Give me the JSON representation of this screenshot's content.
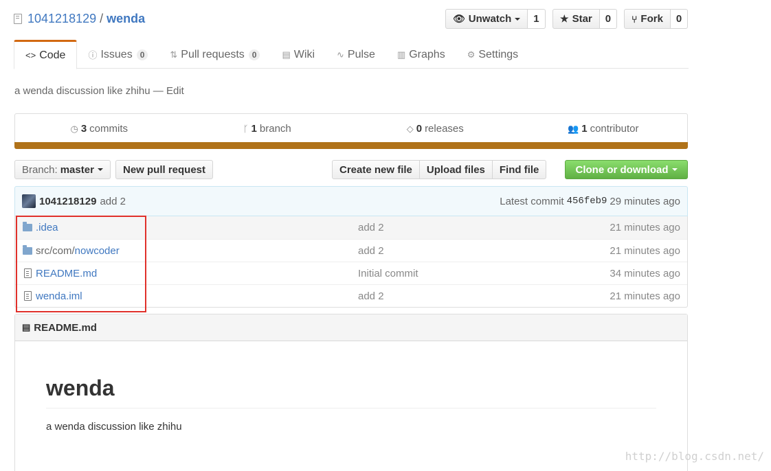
{
  "repo": {
    "owner": "1041218129",
    "separator": "/",
    "name": "wenda"
  },
  "actions": {
    "unwatch_label": "Unwatch",
    "unwatch_count": "1",
    "star_label": "Star",
    "star_count": "0",
    "fork_label": "Fork",
    "fork_count": "0"
  },
  "tabs": [
    {
      "label": "Code",
      "icon": "code-icon"
    },
    {
      "label": "Issues",
      "count": "0",
      "icon": "issue-opened-icon"
    },
    {
      "label": "Pull requests",
      "count": "0",
      "icon": "git-pull-request-icon"
    },
    {
      "label": "Wiki",
      "icon": "book-icon"
    },
    {
      "label": "Pulse",
      "icon": "pulse-icon"
    },
    {
      "label": "Graphs",
      "icon": "graph-icon"
    },
    {
      "label": "Settings",
      "icon": "gear-icon"
    }
  ],
  "description": {
    "text": "a wenda discussion like zhihu",
    "dash": "—",
    "edit": "Edit"
  },
  "summary": {
    "commits_num": "3",
    "commits_label": "commits",
    "branch_num": "1",
    "branch_label": "branch",
    "releases_num": "0",
    "releases_label": "releases",
    "contributor_num": "1",
    "contributor_label": "contributor",
    "language_color": "#b07219"
  },
  "file_nav": {
    "branch_prefix": "Branch:",
    "branch_name": "master",
    "new_pull_request": "New pull request",
    "create_new_file": "Create new file",
    "upload_files": "Upload files",
    "find_file": "Find file",
    "clone_or_download": "Clone or download"
  },
  "latest_commit": {
    "author": "1041218129",
    "message": "add 2",
    "prefix": "Latest commit",
    "sha": "456feb9",
    "age": "29 minutes ago"
  },
  "files": [
    {
      "type": "folder",
      "name": ".idea",
      "dim": "",
      "message": "add 2",
      "age": "21 minutes ago"
    },
    {
      "type": "folder",
      "dim": "src/com/",
      "name": "nowcoder",
      "message": "add 2",
      "age": "21 minutes ago"
    },
    {
      "type": "file",
      "name": "README.md",
      "dim": "",
      "message": "Initial commit",
      "age": "34 minutes ago"
    },
    {
      "type": "file",
      "name": "wenda.iml",
      "dim": "",
      "message": "add 2",
      "age": "21 minutes ago"
    }
  ],
  "readme": {
    "filename": "README.md",
    "heading": "wenda",
    "body": "a wenda discussion like zhihu"
  },
  "watermark": "http://blog.csdn.net/",
  "colors": {
    "accent_tab": "#d26911",
    "clone_green": "#60b044",
    "highlight_red": "#e0302a",
    "link": "#4078c0"
  }
}
